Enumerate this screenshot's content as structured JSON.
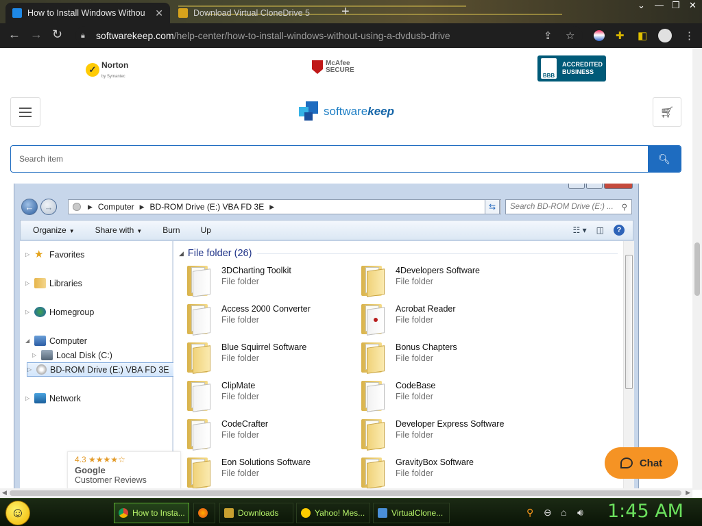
{
  "browser": {
    "tabs": [
      {
        "title": "How to Install Windows Withou",
        "active": true
      },
      {
        "title": "Download Virtual CloneDrive 5",
        "active": false
      }
    ],
    "address": {
      "domain": "softwarekeep.com",
      "path": "/help-center/how-to-install-windows-without-using-a-dvdusb-drive"
    }
  },
  "trust_badges": {
    "norton": "Norton",
    "norton_sub": "by Symantec",
    "mcafee_line1": "McAfee",
    "mcafee_line2": "SECURE",
    "bbb_seal": "BBB",
    "bbb_line1": "ACCREDITED",
    "bbb_line2": "BUSINESS"
  },
  "site": {
    "logo_prefix": "software",
    "logo_suffix": "keep",
    "search_placeholder": "Search item"
  },
  "explorer": {
    "breadcrumb": [
      "Computer",
      "BD-ROM Drive (E:) VBA FD 3E"
    ],
    "search_placeholder": "Search BD-ROM Drive (E:) ...",
    "commands": [
      "Organize",
      "Share with",
      "Burn",
      "Up"
    ],
    "nav": {
      "favorites": "Favorites",
      "libraries": "Libraries",
      "homegroup": "Homegroup",
      "computer": "Computer",
      "local_disk": "Local Disk (C:)",
      "bd_drive": "BD-ROM Drive (E:) VBA FD 3E",
      "network": "Network"
    },
    "group_header": "File folder (26)",
    "items": [
      {
        "name": "3DCharting Toolkit",
        "type": "File folder"
      },
      {
        "name": "4Developers Software",
        "type": "File folder"
      },
      {
        "name": "Access 2000 Converter",
        "type": "File folder"
      },
      {
        "name": "Acrobat Reader",
        "type": "File folder"
      },
      {
        "name": "Blue Squirrel Software",
        "type": "File folder"
      },
      {
        "name": "Bonus Chapters",
        "type": "File folder"
      },
      {
        "name": "ClipMate",
        "type": "File folder"
      },
      {
        "name": "CodeBase",
        "type": "File folder"
      },
      {
        "name": "CodeCrafter",
        "type": "File folder"
      },
      {
        "name": "Developer Express Software",
        "type": "File folder"
      },
      {
        "name": "Eon Solutions Software",
        "type": "File folder"
      },
      {
        "name": "GravityBox Software",
        "type": "File folder"
      }
    ]
  },
  "google_reviews": {
    "rating": "4.3",
    "stars": "★★★★☆",
    "brand": "Google",
    "label": "Customer Reviews"
  },
  "chat": {
    "label": "Chat"
  },
  "taskbar": {
    "buttons": [
      "How to Insta...",
      "Downloads",
      "Yahoo! Mes...",
      "VirtualClone..."
    ],
    "clock": "1:45 AM"
  },
  "colors": {
    "accent": "#1e6cc0",
    "chat": "#f59324",
    "clock": "#6be05d",
    "taskbar_text": "#b7f56a"
  }
}
